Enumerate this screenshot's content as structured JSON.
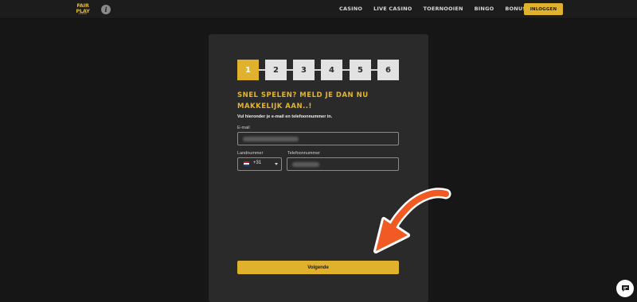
{
  "header": {
    "logo_line1": "FAIR",
    "logo_line2": "PLAY",
    "logo_line3": "CASINO",
    "nav": [
      "CASINO",
      "LIVE CASINO",
      "TOERNOOIEN",
      "BINGO",
      "BONUS"
    ],
    "login_label": "INLOGGEN"
  },
  "steps": {
    "items": [
      "1",
      "2",
      "3",
      "4",
      "5",
      "6"
    ],
    "active_index": 0
  },
  "form": {
    "headline": "SNEL SPELEN? MELD JE DAN NU MAKKELIJK AAN..!",
    "subtitle": "Vul hieronder je e-mail en telefoonnummer in.",
    "email_label": "E-mail",
    "country_label": "Landnummer",
    "country_code": "+31",
    "phone_label": "Telefoonnummer",
    "next_label": "Volgende"
  },
  "colors": {
    "accent": "#e0b12d",
    "annotation_arrow": "#f15a22",
    "background": "#161616",
    "panel": "#2a2a2a"
  },
  "icons": [
    "info-icon",
    "flag-nl-icon",
    "chevron-down-icon",
    "chat-icon"
  ]
}
